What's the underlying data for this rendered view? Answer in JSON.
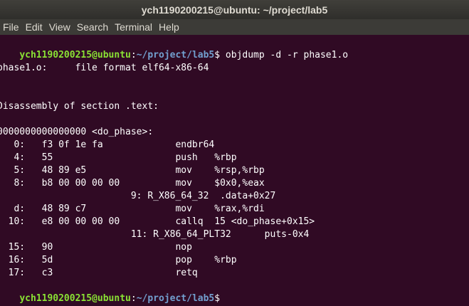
{
  "window": {
    "title": "ych1190200215@ubuntu: ~/project/lab5"
  },
  "menu": [
    "File",
    "Edit",
    "View",
    "Search",
    "Terminal",
    "Help"
  ],
  "prompt": {
    "user_host": "ych1190200215@ubuntu",
    "colon": ":",
    "path": "~/project/lab5",
    "dollar": "$ "
  },
  "command": "objdump -d -r phase1.o",
  "output_lines": [
    "",
    "phase1.o:     file format elf64-x86-64",
    "",
    "",
    "Disassembly of section .text:",
    "",
    "0000000000000000 <do_phase>:",
    "   0:   f3 0f 1e fa             endbr64",
    "   4:   55                      push   %rbp",
    "   5:   48 89 e5                mov    %rsp,%rbp",
    "   8:   b8 00 00 00 00          mov    $0x0,%eax",
    "                        9: R_X86_64_32  .data+0x27",
    "   d:   48 89 c7                mov    %rax,%rdi",
    "  10:   e8 00 00 00 00          callq  15 <do_phase+0x15>",
    "                        11: R_X86_64_PLT32      puts-0x4",
    "  15:   90                      nop",
    "  16:   5d                      pop    %rbp",
    "  17:   c3                      retq"
  ]
}
